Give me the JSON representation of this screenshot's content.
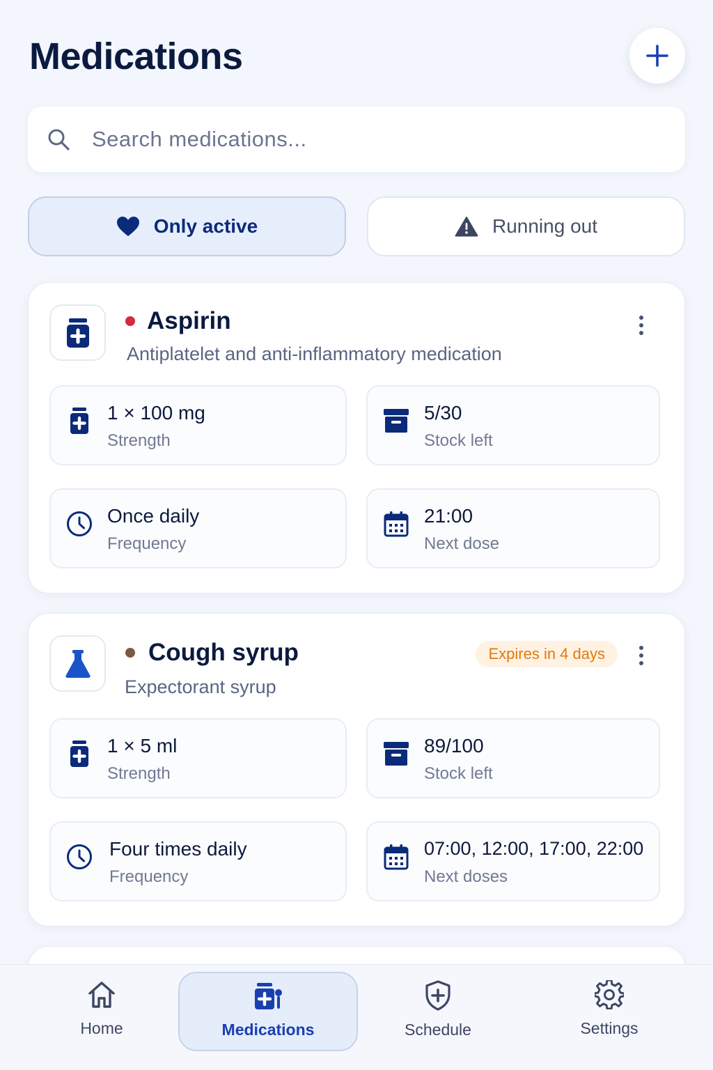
{
  "header": {
    "title": "Medications",
    "add_icon": "plus-icon"
  },
  "search": {
    "placeholder": "Search medications...",
    "icon": "search-icon"
  },
  "filters": [
    {
      "label": "Only active",
      "icon": "heart-icon",
      "selected": true
    },
    {
      "label": "Running out",
      "icon": "warning-icon",
      "selected": false
    }
  ],
  "medications": [
    {
      "name": "Aspirin",
      "description": "Antiplatelet and anti-inflammatory medication",
      "status_color": "#d42a3f",
      "icon": "pill-bottle-icon",
      "badge": "",
      "strength": {
        "value": "1 × 100 mg",
        "label": "Strength"
      },
      "stock": {
        "value": "5/30",
        "label": "Stock left"
      },
      "frequency": {
        "value": "Once daily",
        "label": "Frequency"
      },
      "next": {
        "value": "21:00",
        "label": "Next dose"
      }
    },
    {
      "name": "Cough syrup",
      "description": "Expectorant syrup",
      "status_color": "#7a5a44",
      "icon": "flask-icon",
      "badge": "Expires in 4 days",
      "strength": {
        "value": "1 × 5 ml",
        "label": "Strength"
      },
      "stock": {
        "value": "89/100",
        "label": "Stock left"
      },
      "frequency": {
        "value": "Four times daily",
        "label": "Frequency"
      },
      "next": {
        "value": "07:00, 12:00, 17:00, 22:00",
        "label": "Next doses"
      }
    }
  ],
  "nav": [
    {
      "label": "Home",
      "icon": "home-icon",
      "selected": false
    },
    {
      "label": "Medications",
      "icon": "medications-icon",
      "selected": true
    },
    {
      "label": "Schedule",
      "icon": "shield-plus-icon",
      "selected": false
    },
    {
      "label": "Settings",
      "icon": "gear-icon",
      "selected": false
    }
  ],
  "colors": {
    "accent": "#1a3fb0",
    "navy": "#0b2a7a",
    "warning": "#e07a10",
    "background": "#f3f6fc"
  }
}
